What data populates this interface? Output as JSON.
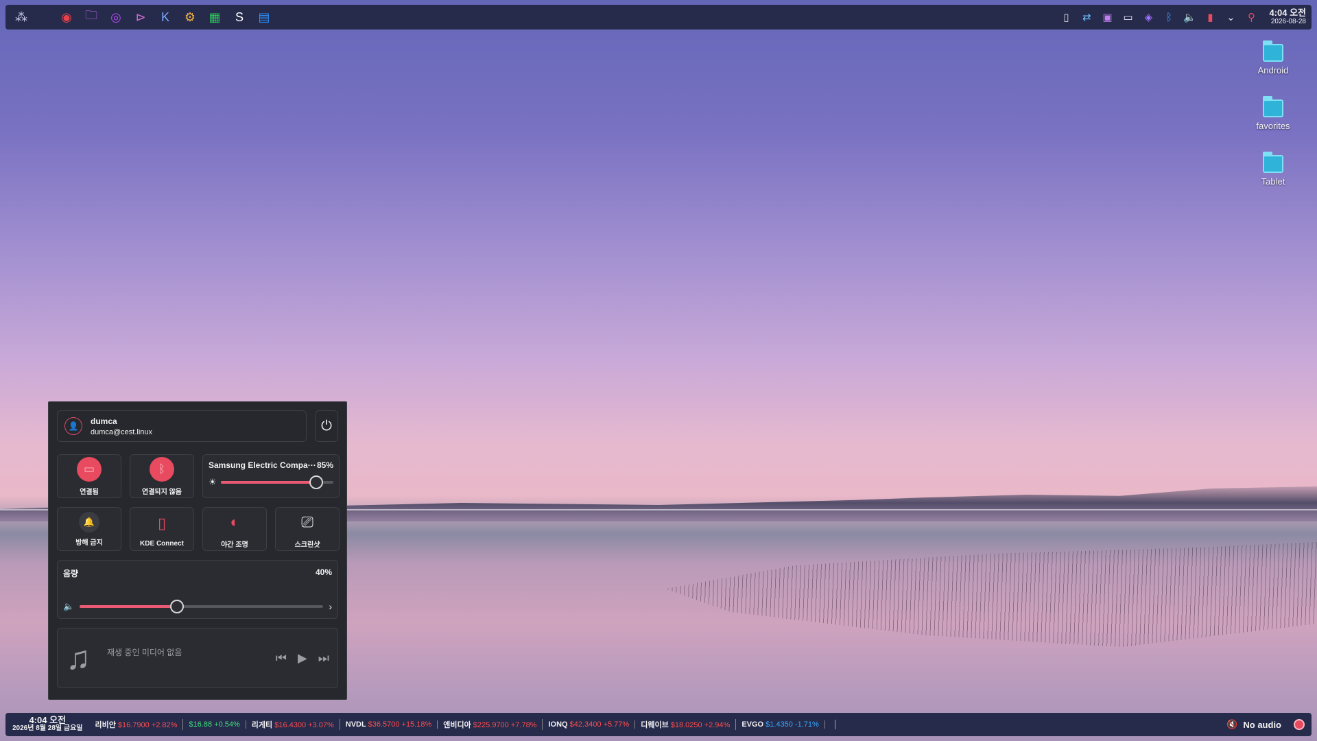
{
  "top_panel": {
    "launcher_icons": [
      {
        "name": "app-launcher-icon",
        "glyph": "⁂",
        "color": "#c8c8e8"
      },
      {
        "name": "browser-icon",
        "glyph": "◉",
        "color": "#e8434a"
      },
      {
        "name": "file-manager-icon",
        "glyph": "🗀",
        "color": "#c46cf0"
      },
      {
        "name": "screen-recorder-icon",
        "glyph": "◎",
        "color": "#b04cf0"
      },
      {
        "name": "terminal-icon",
        "glyph": "⊳",
        "color": "#d06cd0"
      },
      {
        "name": "kde-icon",
        "glyph": "K",
        "color": "#7aa8ff"
      },
      {
        "name": "settings-icon",
        "glyph": "⚙",
        "color": "#f0b040"
      },
      {
        "name": "spreadsheet-icon",
        "glyph": "▦",
        "color": "#2ec05a"
      },
      {
        "name": "app-s-icon",
        "glyph": "S",
        "color": "#ffffff"
      },
      {
        "name": "writer-icon",
        "glyph": "▤",
        "color": "#2d8cf0"
      }
    ],
    "tray_icons": [
      {
        "name": "clipboard-icon",
        "glyph": "▯",
        "color": "#dcdcdc"
      },
      {
        "name": "network-icon",
        "glyph": "⇄",
        "color": "#6ac0ff"
      },
      {
        "name": "notes-icon",
        "glyph": "▣",
        "color": "#c080f0"
      },
      {
        "name": "display-icon",
        "glyph": "▭",
        "color": "#e8e8ff"
      },
      {
        "name": "vpn-icon",
        "glyph": "◈",
        "color": "#a070ff"
      },
      {
        "name": "bluetooth-icon",
        "glyph": "ᛒ",
        "color": "#40a0ff"
      },
      {
        "name": "volume-icon",
        "glyph": "🔈",
        "color": "#7ecb6b"
      },
      {
        "name": "phone-icon",
        "glyph": "▮",
        "color": "#e84a5f"
      },
      {
        "name": "expand-tray-icon",
        "glyph": "⌄",
        "color": "#dcdcdc"
      },
      {
        "name": "search-icon",
        "glyph": "⚲",
        "color": "#e84a5f"
      }
    ],
    "clock_time": "4:04 오전",
    "clock_date": "2026-08-28"
  },
  "desktop_icons": [
    {
      "label": "Android"
    },
    {
      "label": "favorites"
    },
    {
      "label": "Tablet"
    }
  ],
  "quick_settings": {
    "user_name": "dumca",
    "user_email": "dumca@cest.linux",
    "tiles": [
      {
        "label": "연결됨",
        "icon": "network-icon",
        "glyph": "▭",
        "style": "red"
      },
      {
        "label": "연결되지 않음",
        "icon": "bluetooth-icon",
        "glyph": "ᛒ",
        "style": "red"
      },
      {
        "label": "방해 금지",
        "icon": "bell-icon",
        "glyph": "🔔",
        "style": "gray"
      },
      {
        "label": "KDE Connect",
        "icon": "kde-connect-icon",
        "glyph": "▯",
        "style": "plain"
      },
      {
        "label": "야간 조명",
        "icon": "night-light-icon",
        "glyph": "◐",
        "style": "plain"
      },
      {
        "label": "스크린샷",
        "icon": "screenshot-icon",
        "glyph": "⎚",
        "style": "plain"
      }
    ],
    "brightness": {
      "device": "Samsung Electric Compa···",
      "value_label": "85%",
      "level": 0.85
    },
    "volume": {
      "title": "음량",
      "value_label": "40%",
      "level": 0.4
    },
    "media": {
      "status": "재생 중인 미디어 없음"
    }
  },
  "bottom_panel": {
    "clock_time": "4:04 오전",
    "clock_date": "2026년 8월 28일 금요일",
    "stocks": [
      {
        "name": "리비안",
        "price": "$16.7900",
        "change": "+2.82%",
        "tone": "up"
      },
      {
        "name": "",
        "price": "$16.88",
        "change": "+0.54%",
        "tone": "upg"
      },
      {
        "name": "리게티",
        "price": "$16.4300",
        "change": "+3.07%",
        "tone": "up"
      },
      {
        "name": "NVDL",
        "price": "$36.5700",
        "change": "+15.18%",
        "tone": "up"
      },
      {
        "name": "엔비디아",
        "price": "$225.9700",
        "change": "+7.78%",
        "tone": "up"
      },
      {
        "name": "IONQ",
        "price": "$42.3400",
        "change": "+5.77%",
        "tone": "up"
      },
      {
        "name": "디웨이브",
        "price": "$18.0250",
        "change": "+2.94%",
        "tone": "up"
      },
      {
        "name": "EVGO",
        "price": "$1.4350",
        "change": "-1.71%",
        "tone": "down"
      }
    ],
    "audio_label": "No audio"
  },
  "colors": {
    "accent": "#e84a5f",
    "panel": "#262a4b",
    "popup": "#26282d",
    "price_up": "#ff4d4d",
    "price_down": "#35a8ff"
  }
}
